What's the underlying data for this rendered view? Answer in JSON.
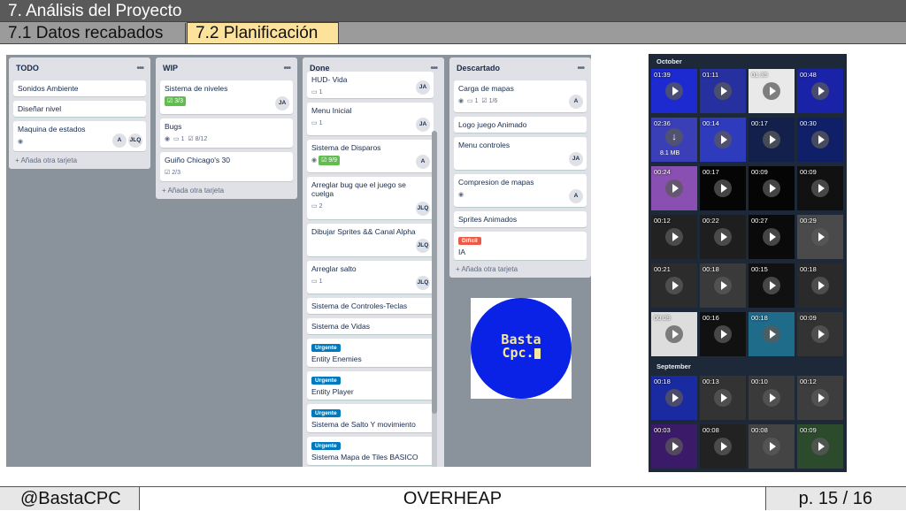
{
  "slide": {
    "title": "7. Análisis del Proyecto",
    "tabs": [
      "7.1 Datos recabados",
      "7.2 Planificación"
    ],
    "footer": {
      "left": "@BastaCPC",
      "center": "OVERHEAP",
      "right": "p. 15 / 16"
    }
  },
  "board": {
    "add_card": "+ Añada otra tarjeta",
    "lists": [
      {
        "title": "TODO",
        "cards": [
          {
            "text": "Sonidos Ambiente"
          },
          {
            "text": "Diseñar nivel"
          },
          {
            "text": "Maquina de estados",
            "avatars": [
              "A",
              "JLQ"
            ]
          }
        ]
      },
      {
        "title": "WIP",
        "cards": [
          {
            "text": "Sistema de niveles",
            "checklist": "3/3",
            "avatars": [
              "JA"
            ]
          },
          {
            "text": "Bugs",
            "comments": "1",
            "checklist": "8/12"
          },
          {
            "text": "Guiño Chicago's 30",
            "checklist": "2/3"
          }
        ]
      },
      {
        "title": "Done",
        "cards": [
          {
            "text": "HUD- Vida",
            "comments": "1",
            "avatars": [
              "JA"
            ]
          },
          {
            "text": "Menu Inicial",
            "comments": "1",
            "avatars": [
              "JA"
            ]
          },
          {
            "text": "Sistema de Disparos",
            "checklist": "9/9",
            "avatars": [
              "A"
            ]
          },
          {
            "text": "Arreglar bug que el juego se cuelga",
            "comments": "2",
            "avatars": [
              "JLQ"
            ]
          },
          {
            "text": "Dibujar Sprites && Canal Alpha",
            "avatars": [
              "JLQ"
            ]
          },
          {
            "text": "Arreglar salto",
            "comments": "1",
            "avatars": [
              "JLQ"
            ]
          },
          {
            "text": "Sistema de Controles-Teclas"
          },
          {
            "text": "Sistema de Vidas"
          },
          {
            "text": "Entity Enemies",
            "label": "Urgente"
          },
          {
            "text": "Entity Player",
            "label": "Urgente"
          },
          {
            "text": "Sistema de Salto Y movimiento",
            "label": "Urgente"
          },
          {
            "text": "Sistema Mapa de Tiles BASICO",
            "label": "Urgente"
          }
        ]
      },
      {
        "title": "Descartado",
        "cards": [
          {
            "text": "Carga de mapas",
            "comments": "1",
            "checklist": "1/6",
            "avatars": [
              "A"
            ]
          },
          {
            "text": "Logo juego Animado"
          },
          {
            "text": "Menu controles",
            "avatars": [
              "JA"
            ]
          },
          {
            "text": "Compresion de mapas",
            "avatars": [
              "A"
            ]
          },
          {
            "text": "Sprites Animados"
          },
          {
            "text": "IA",
            "label": "Difícil"
          }
        ]
      }
    ],
    "colors": {
      "urgente": "#0079bf",
      "dificil": "#eb5a46",
      "check": "#61bd4f"
    }
  },
  "logo": {
    "line1": "Basta",
    "line2": "Cpc."
  },
  "gallery": {
    "months": [
      "October",
      "September"
    ],
    "october": [
      "01:39",
      "01:11",
      "01:35",
      "00:48",
      "02:36",
      "00:14",
      "00:17",
      "00:30",
      "00:24",
      "00:17",
      "00:09",
      "00:09",
      "00:12",
      "00:22",
      "00:27",
      "00:29",
      "00:21",
      "00:18",
      "00:15",
      "00:18",
      "00:09",
      "00:16",
      "00:18",
      "00:09"
    ],
    "download_size": "8.1 MB",
    "september": [
      "00:18",
      "00:13",
      "00:10",
      "00:12",
      "00:03",
      "00:08",
      "00:08",
      "00:09"
    ]
  }
}
